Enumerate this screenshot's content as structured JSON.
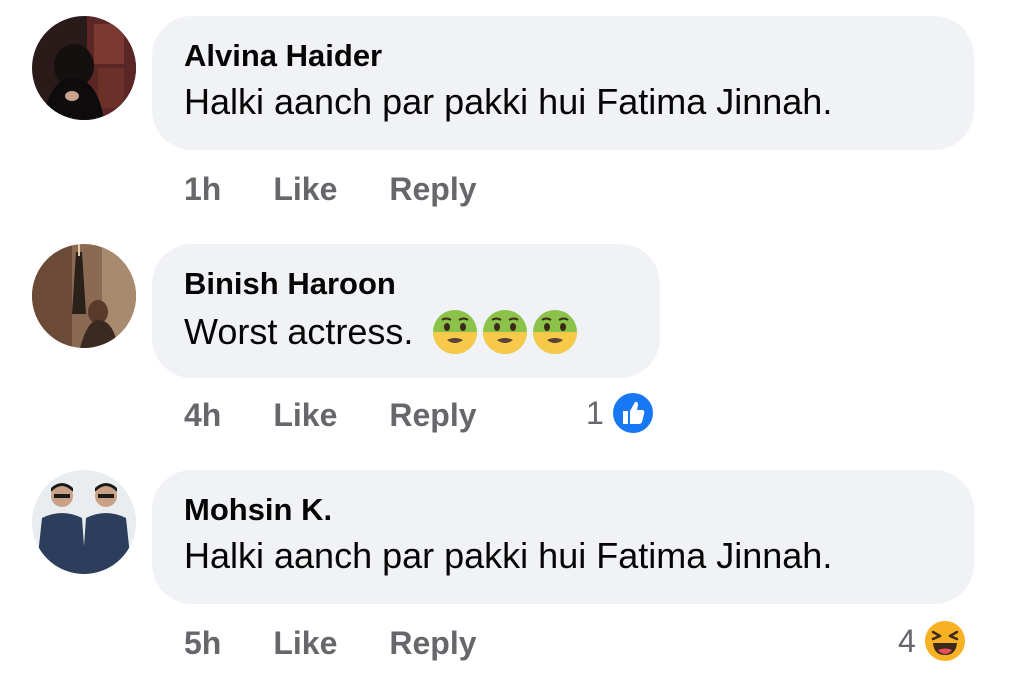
{
  "comments": [
    {
      "author": "Alvina Haider",
      "text": "Halki aanch par pakki hui Fatima Jinnah.",
      "time": "1h",
      "like_label": "Like",
      "reply_label": "Reply"
    },
    {
      "author": "Binish Haroon",
      "text": "Worst actress.",
      "emojis": [
        "nauseated-face",
        "nauseated-face",
        "nauseated-face"
      ],
      "time": "4h",
      "like_label": "Like",
      "reply_label": "Reply",
      "reaction": {
        "count": "1",
        "icon": "like-reaction-icon",
        "color": "#1877f2"
      }
    },
    {
      "author": "Mohsin K.",
      "text": "Halki aanch par pakki hui Fatima Jinnah.",
      "time": "5h",
      "like_label": "Like",
      "reply_label": "Reply",
      "reaction": {
        "count": "4",
        "icon": "haha-reaction-icon",
        "color": "#f7b125"
      }
    }
  ],
  "colors": {
    "bubble": "#f0f2f5",
    "meta": "#65676b",
    "text": "#050505"
  }
}
